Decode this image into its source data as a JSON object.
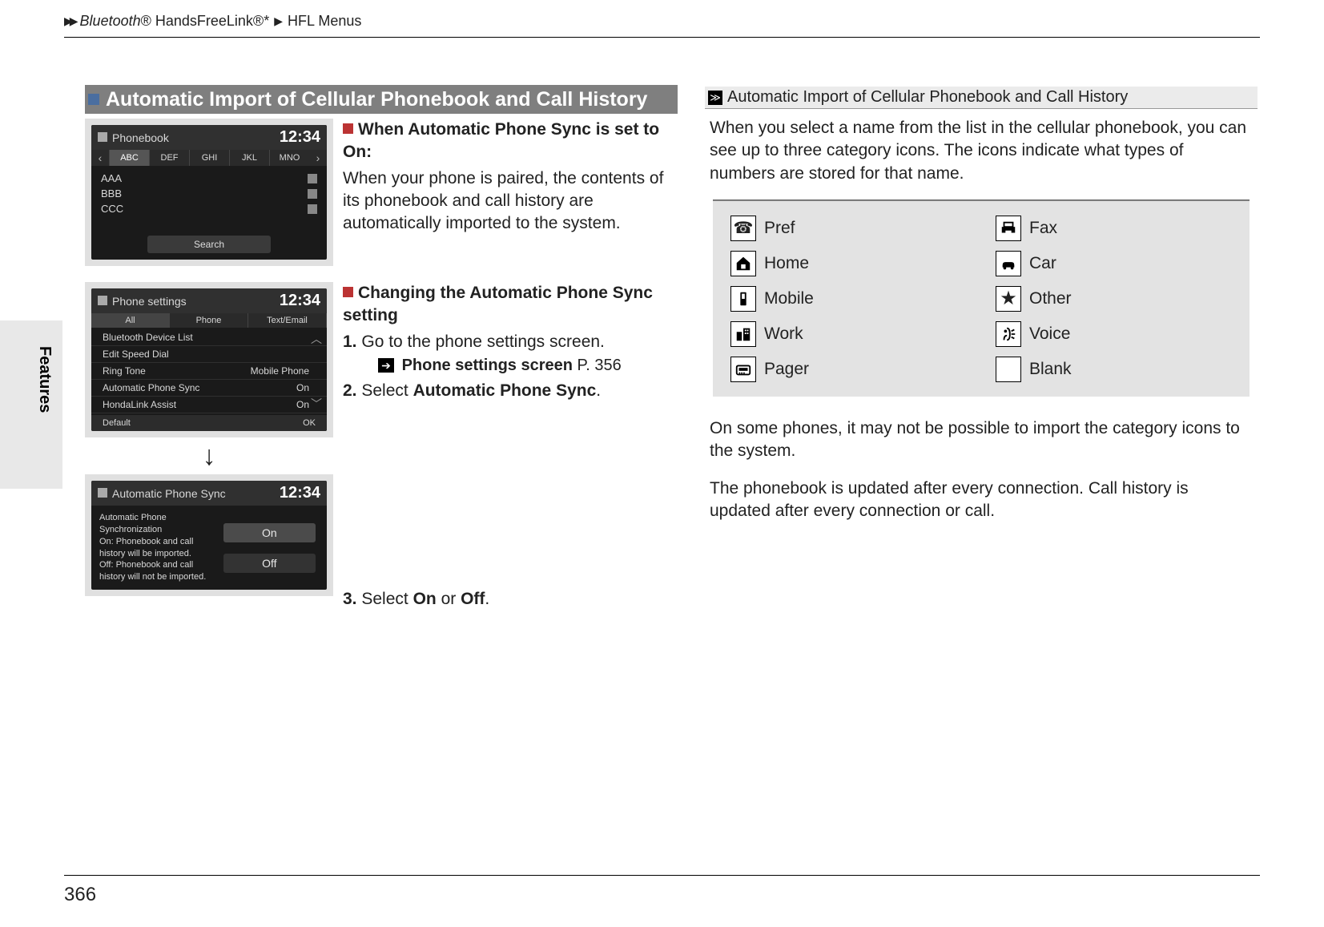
{
  "breadcrumb": {
    "brand": "Bluetooth",
    "brand_suffix": "® HandsFreeLink®*",
    "tail": "HFL Menus"
  },
  "side_tab": "Features",
  "page_number": "366",
  "section_title": "Automatic Import of Cellular Phonebook and Call History",
  "block1": {
    "heading": "When Automatic Phone Sync is set to On:",
    "body": "When your phone is paired, the contents of its phonebook and call history are automatically imported to the system."
  },
  "block2": {
    "heading": "Changing the Automatic Phone Sync setting",
    "step1_num": "1.",
    "step1_text": "Go to the phone settings screen.",
    "crossref_label": "Phone settings screen",
    "crossref_page": "P. 356",
    "step2_num": "2.",
    "step2_text_pre": "Select ",
    "step2_bold": "Automatic Phone Sync",
    "step2_text_post": "."
  },
  "block3": {
    "step3_num": "3.",
    "step3_pre": "Select ",
    "step3_b1": "On",
    "step3_mid": " or ",
    "step3_b2": "Off",
    "step3_post": "."
  },
  "screen1": {
    "title": "Phonebook",
    "clock": "12:34",
    "tabs": [
      "ABC",
      "DEF",
      "GHI",
      "JKL",
      "MNO"
    ],
    "rows": [
      "AAA",
      "BBB",
      "CCC"
    ],
    "search": "Search"
  },
  "screen2": {
    "title": "Phone settings",
    "clock": "12:34",
    "opt_tabs": [
      "All",
      "Phone",
      "Text/Email"
    ],
    "rows": [
      {
        "label": "Bluetooth Device List",
        "value": ""
      },
      {
        "label": "Edit Speed Dial",
        "value": ""
      },
      {
        "label": "Ring Tone",
        "value": "Mobile Phone"
      },
      {
        "label": "Automatic Phone Sync",
        "value": "On"
      },
      {
        "label": "HondaLink Assist",
        "value": "On"
      }
    ],
    "footer_left": "Default",
    "footer_right": "OK"
  },
  "screen3": {
    "title": "Automatic Phone Sync",
    "clock": "12:34",
    "desc": "Automatic Phone Synchronization\nOn: Phonebook and call history will be imported.\nOff: Phonebook and call history will not be imported.",
    "opt_on": "On",
    "opt_off": "Off"
  },
  "sidebar": {
    "title": "Automatic Import of Cellular Phonebook and Call History",
    "p1": "When you select a name from the list in the cellular phonebook, you can see up to three category icons. The icons indicate what types of numbers are stored for that name.",
    "p2": "On some phones, it may not be possible to import the category icons to the system.",
    "p3": "The phonebook is updated after every connection. Call history is updated after every connection or call.",
    "icons": {
      "pref": "Pref",
      "fax": "Fax",
      "home": "Home",
      "car": "Car",
      "mobile": "Mobile",
      "other": "Other",
      "work": "Work",
      "voice": "Voice",
      "pager": "Pager",
      "blank": "Blank"
    }
  }
}
